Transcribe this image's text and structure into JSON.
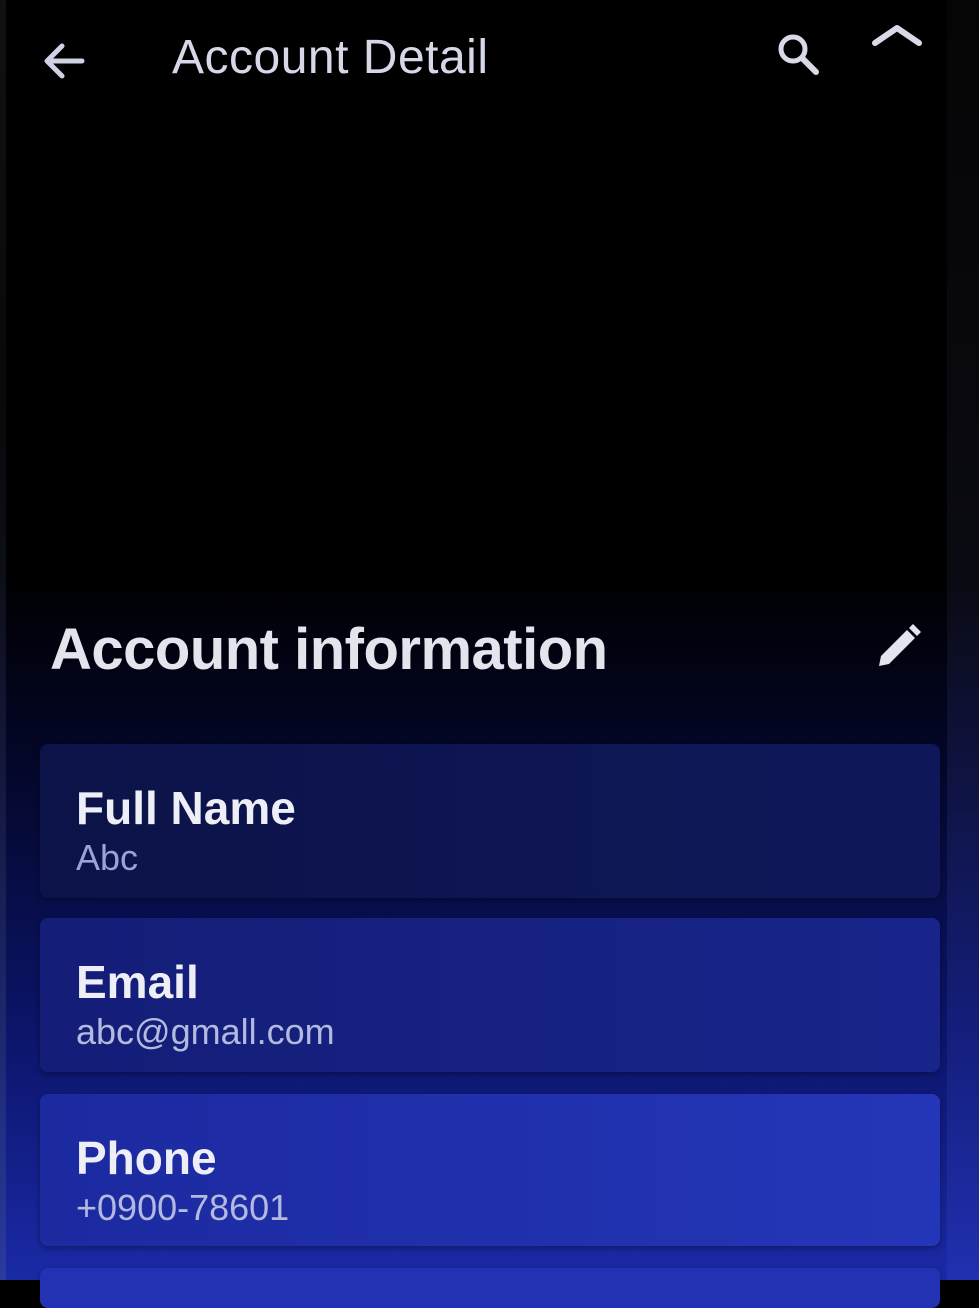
{
  "app_bar": {
    "title": "Account Detail",
    "back_icon": "arrow-left-icon",
    "search_icon": "search-icon",
    "collapse_icon": "chevron-up-icon"
  },
  "section": {
    "title": "Account information",
    "edit_icon": "pencil-icon"
  },
  "fields": [
    {
      "label": "Full Name",
      "value": "Abc"
    },
    {
      "label": "Email",
      "value": "abc@gmall.com"
    },
    {
      "label": "Phone",
      "value": "+0900-78601"
    }
  ],
  "colors": {
    "background_top": "#000000",
    "background_bottom": "#1a2aa6",
    "text_primary": "#eeeef6",
    "text_secondary": "#9aa2d8"
  }
}
